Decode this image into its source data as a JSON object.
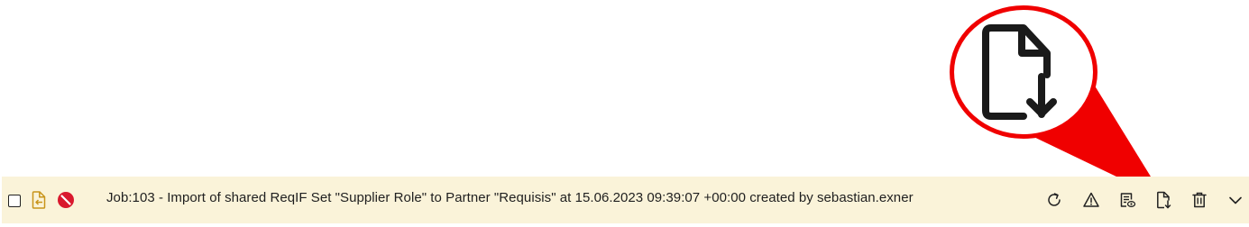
{
  "job_row": {
    "text": "Job:103 - Import of shared ReqIF Set \"Supplier Role\" to Partner \"Requisis\" at 15.06.2023 09:39:07 +00:00 created by sebastian.exner",
    "background": "#faf3d9",
    "status": "error",
    "status_color": "#d9182d",
    "type_icon": "file-import-icon",
    "type_icon_color": "#c8941a"
  },
  "actions": [
    {
      "name": "rerun-button",
      "icon": "refresh-icon"
    },
    {
      "name": "warning-button",
      "icon": "warning-icon"
    },
    {
      "name": "view-log-button",
      "icon": "log-view-icon"
    },
    {
      "name": "download-button",
      "icon": "file-download-icon"
    },
    {
      "name": "delete-button",
      "icon": "trash-icon"
    },
    {
      "name": "expand-button",
      "icon": "chevron-down-icon"
    }
  ],
  "callout": {
    "highlighted_icon": "file-download-icon",
    "color": "#f00000"
  }
}
